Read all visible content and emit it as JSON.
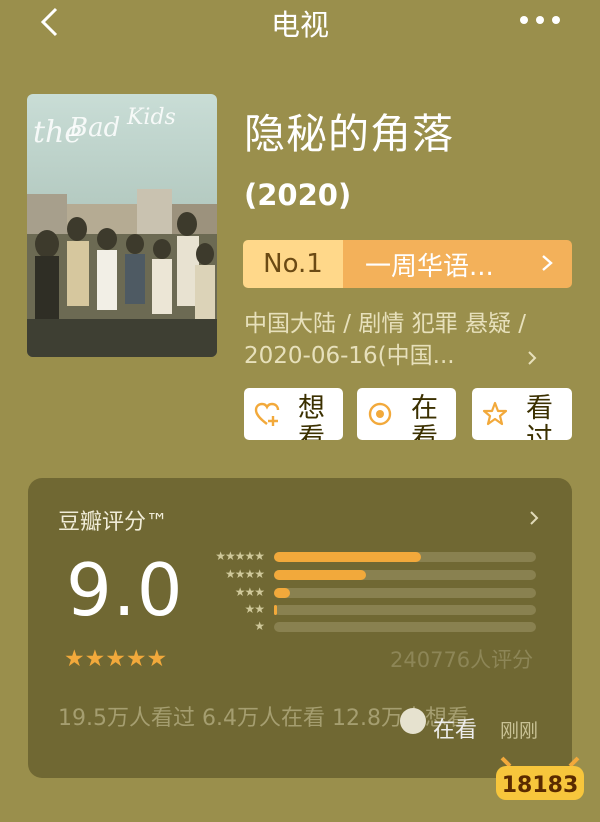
{
  "header": {
    "title": "电视",
    "back_icon": "chevron-left-icon",
    "more_icon": "more-dots-icon"
  },
  "movie": {
    "title": "隐秘的角落",
    "year": "(2020)",
    "poster_text": "the Bad Kids",
    "rank": {
      "number": "No.1",
      "label": "一周华语..."
    },
    "meta": "中国大陆 / 剧情 犯罪 悬疑 / 2020-06-16(中国..."
  },
  "actions": [
    {
      "label": "想看",
      "icon": "heart-plus-icon",
      "color": "#f2a93b"
    },
    {
      "label": "在看",
      "icon": "target-circle-icon",
      "color": "#f2a93b"
    },
    {
      "label": "看过",
      "icon": "star-outline-icon",
      "color": "#f2a93b"
    }
  ],
  "rating": {
    "title": "豆瓣评分™",
    "score": "9.0",
    "stars_value": 4.5,
    "star_glyphs": "★★★★★",
    "count": "240776人评分",
    "distribution": [
      {
        "stars": "★★★★★",
        "percent": 56
      },
      {
        "stars": "★★★★",
        "percent": 35
      },
      {
        "stars": "★★★",
        "percent": 6
      },
      {
        "stars": "★★",
        "percent": 1
      },
      {
        "stars": "★",
        "percent": 0
      }
    ],
    "stats_text": "19.5万人看过   6.4万人在看  12.8万人想看",
    "live_label": "在看",
    "recent_label": "刚刚"
  },
  "watermark": {
    "text": "18183"
  },
  "colors": {
    "background": "#9a8f4c",
    "card": "#706833",
    "accent": "#f2a93b"
  }
}
